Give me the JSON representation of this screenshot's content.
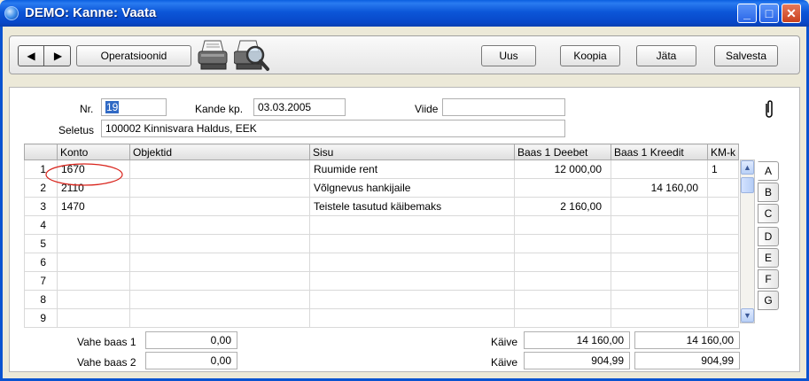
{
  "window": {
    "title": "DEMO: Kanne: Vaata"
  },
  "title_buttons": {
    "minimize": "_",
    "maximize": "□",
    "close": "✕"
  },
  "toolbar": {
    "prev": "◀",
    "next": "▶",
    "operations": "Operatsioonid",
    "new": "Uus",
    "copy": "Koopia",
    "skip": "Jäta",
    "save": "Salvesta"
  },
  "form": {
    "nr_label": "Nr.",
    "nr_value": "19",
    "date_label": "Kande kp.",
    "date_value": "03.03.2005",
    "ref_label": "Viide",
    "ref_value": "",
    "desc_label": "Seletus",
    "desc_value": "100002 Kinnisvara Haldus, EEK"
  },
  "grid": {
    "columns": [
      "Konto",
      "Objektid",
      "Sisu",
      "Baas 1 Deebet",
      "Baas 1 Kreedit",
      "KM-k"
    ],
    "rows": [
      {
        "n": "1",
        "konto": "1670",
        "objektid": "",
        "sisu": "Ruumide rent",
        "deebet": "12 000,00",
        "kreedit": "",
        "kmk": "1"
      },
      {
        "n": "2",
        "konto": "2110",
        "objektid": "",
        "sisu": "Võlgnevus hankijaile",
        "deebet": "",
        "kreedit": "14 160,00",
        "kmk": ""
      },
      {
        "n": "3",
        "konto": "1470",
        "objektid": "",
        "sisu": "Teistele tasutud käibemaks",
        "deebet": "2 160,00",
        "kreedit": "",
        "kmk": ""
      },
      {
        "n": "4",
        "konto": "",
        "objektid": "",
        "sisu": "",
        "deebet": "",
        "kreedit": "",
        "kmk": ""
      },
      {
        "n": "5",
        "konto": "",
        "objektid": "",
        "sisu": "",
        "deebet": "",
        "kreedit": "",
        "kmk": ""
      },
      {
        "n": "6",
        "konto": "",
        "objektid": "",
        "sisu": "",
        "deebet": "",
        "kreedit": "",
        "kmk": ""
      },
      {
        "n": "7",
        "konto": "",
        "objektid": "",
        "sisu": "",
        "deebet": "",
        "kreedit": "",
        "kmk": ""
      },
      {
        "n": "8",
        "konto": "",
        "objektid": "",
        "sisu": "",
        "deebet": "",
        "kreedit": "",
        "kmk": ""
      },
      {
        "n": "9",
        "konto": "",
        "objektid": "",
        "sisu": "",
        "deebet": "",
        "kreedit": "",
        "kmk": ""
      }
    ]
  },
  "scrollbar": {
    "up": "▲",
    "down": "▼"
  },
  "tabs": [
    "A",
    "B",
    "C",
    "D",
    "E",
    "F",
    "G"
  ],
  "totals": {
    "vahe1_label": "Vahe baas 1",
    "vahe1_value": "0,00",
    "vahe2_label": "Vahe baas 2",
    "vahe2_value": "0,00",
    "kaive1_label": "Käive",
    "kaive1_debit": "14 160,00",
    "kaive1_credit": "14 160,00",
    "kaive2_label": "Käive",
    "kaive2_debit": "904,99",
    "kaive2_credit": "904,99"
  },
  "colors": {
    "titlebar": "#0a53d0",
    "selection": "#316ac5",
    "annotation": "#d9241c"
  }
}
